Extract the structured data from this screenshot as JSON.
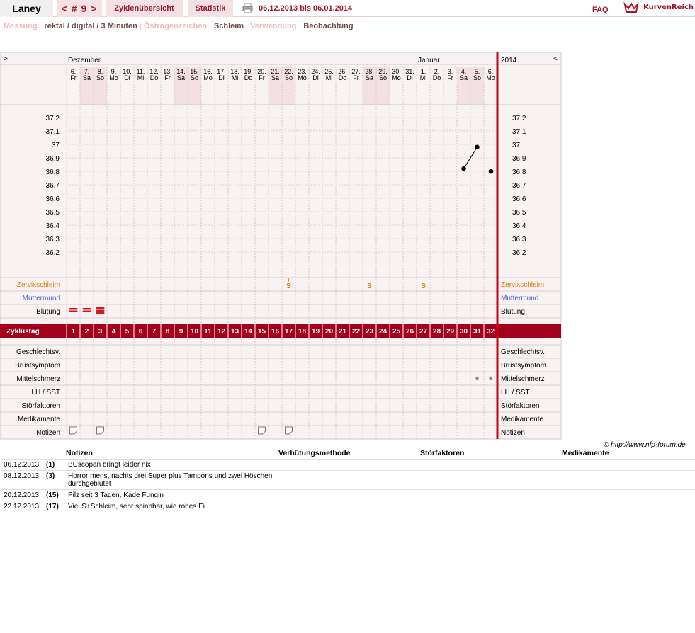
{
  "header": {
    "user": "Laney",
    "cycle": "< # 9 >",
    "overview": "Zyklenübersicht",
    "stats": "Statistik",
    "range": "06.12.2013 bis 06.01.2014",
    "faq": "FAQ",
    "brand": "KurvenReich"
  },
  "meta": {
    "label1": "Messung:",
    "value1": "rektal / digital / 3 Minuten",
    "sep": "|",
    "label2": "Östrogenzeichen:",
    "value2": "Schleim",
    "label3": "Verwendung:",
    "value3": "Beobachtung"
  },
  "chart_data": {
    "type": "line",
    "months": [
      "Dezember",
      "Januar"
    ],
    "year": "2014",
    "nav_left": ">",
    "nav_right": "<",
    "dates": [
      "6.",
      "7.",
      "8.",
      "9.",
      "10.",
      "11.",
      "12.",
      "13.",
      "14.",
      "15.",
      "16.",
      "17.",
      "18.",
      "19.",
      "20.",
      "21.",
      "22.",
      "23.",
      "24.",
      "25.",
      "26.",
      "27.",
      "28.",
      "29.",
      "30.",
      "31.",
      "1.",
      "2.",
      "3.",
      "4.",
      "5.",
      "6."
    ],
    "weekdays": [
      "Fr",
      "Sa",
      "So",
      "Mo",
      "Di",
      "Mi",
      "Do",
      "Fr",
      "Sa",
      "So",
      "Mo",
      "Di",
      "Mi",
      "Do",
      "Fr",
      "Sa",
      "So",
      "Mo",
      "Di",
      "Mi",
      "Do",
      "Fr",
      "Sa",
      "So",
      "Mo",
      "Di",
      "Mi",
      "Do",
      "Fr",
      "Sa",
      "So",
      "Mo"
    ],
    "weekend": [
      1,
      2,
      8,
      9,
      15,
      16,
      22,
      23,
      29,
      30
    ],
    "cycle_days": [
      "1",
      "2",
      "3",
      "4",
      "5",
      "6",
      "7",
      "8",
      "9",
      "10",
      "11",
      "12",
      "13",
      "14",
      "15",
      "16",
      "17",
      "18",
      "19",
      "20",
      "21",
      "22",
      "23",
      "24",
      "25",
      "26",
      "27",
      "28",
      "29",
      "30",
      "31",
      "32"
    ],
    "y_ticks": [
      "37.2",
      "37.1",
      "37",
      "36.9",
      "36.8",
      "36.7",
      "36.6",
      "36.5",
      "36.4",
      "36.3",
      "36.2"
    ],
    "ylim": [
      36.2,
      37.2
    ],
    "temperatures": [
      {
        "day": 30,
        "value": 36.82
      },
      {
        "day": 31,
        "value": 36.98
      },
      {
        "day": 33,
        "value": 36.8
      }
    ],
    "temp_lines": [
      [
        30,
        31
      ]
    ],
    "mucus": [
      {
        "day": 17,
        "value": "S+"
      },
      {
        "day": 23,
        "value": "S"
      },
      {
        "day": 27,
        "value": "S"
      }
    ],
    "bleeding": [
      {
        "day": 1,
        "level": 2
      },
      {
        "day": 2,
        "level": 2
      },
      {
        "day": 3,
        "level": 3
      }
    ],
    "pain": [
      31,
      32,
      33
    ],
    "notes_days": [
      1,
      3,
      15,
      17
    ],
    "labels": {
      "mucus": "Zervixschleim",
      "cervix": "Muttermund",
      "bleeding": "Blutung",
      "cycle_day": "Zyklustag",
      "sex": "Geschlechtsv.",
      "breast": "Brustsymptom",
      "midpain": "Mittelschmerz",
      "lh": "LH / SST",
      "disturb": "Störfaktoren",
      "meds": "Medikamente",
      "notes": "Notizen"
    },
    "colors": {
      "accent": "#a3001b",
      "mucus": "#e07a00",
      "cervix": "#4a59c8",
      "bg": "#f9f2f2",
      "weekend": "#f2e0e2"
    }
  },
  "copyright": "© http://www.nfp-forum.de",
  "notes_table": {
    "headers": [
      "Notizen",
      "Verhütungsmethode",
      "Störfaktoren",
      "Medikamente"
    ],
    "rows": [
      {
        "date": "06.12.2013",
        "day": "(1)",
        "note": "BUscopan bringt leider nix"
      },
      {
        "date": "08.12.2013",
        "day": "(3)",
        "note": "Horror mens, nachts drei Super plus Tampons und zwei Höschen durchgeblutet"
      },
      {
        "date": "20.12.2013",
        "day": "(15)",
        "note": "Pilz seit 3 Tagen, Kade Fungin"
      },
      {
        "date": "22.12.2013",
        "day": "(17)",
        "note": "Viel S+Schleim, sehr spinnbar, wie rohes Ei"
      }
    ]
  }
}
